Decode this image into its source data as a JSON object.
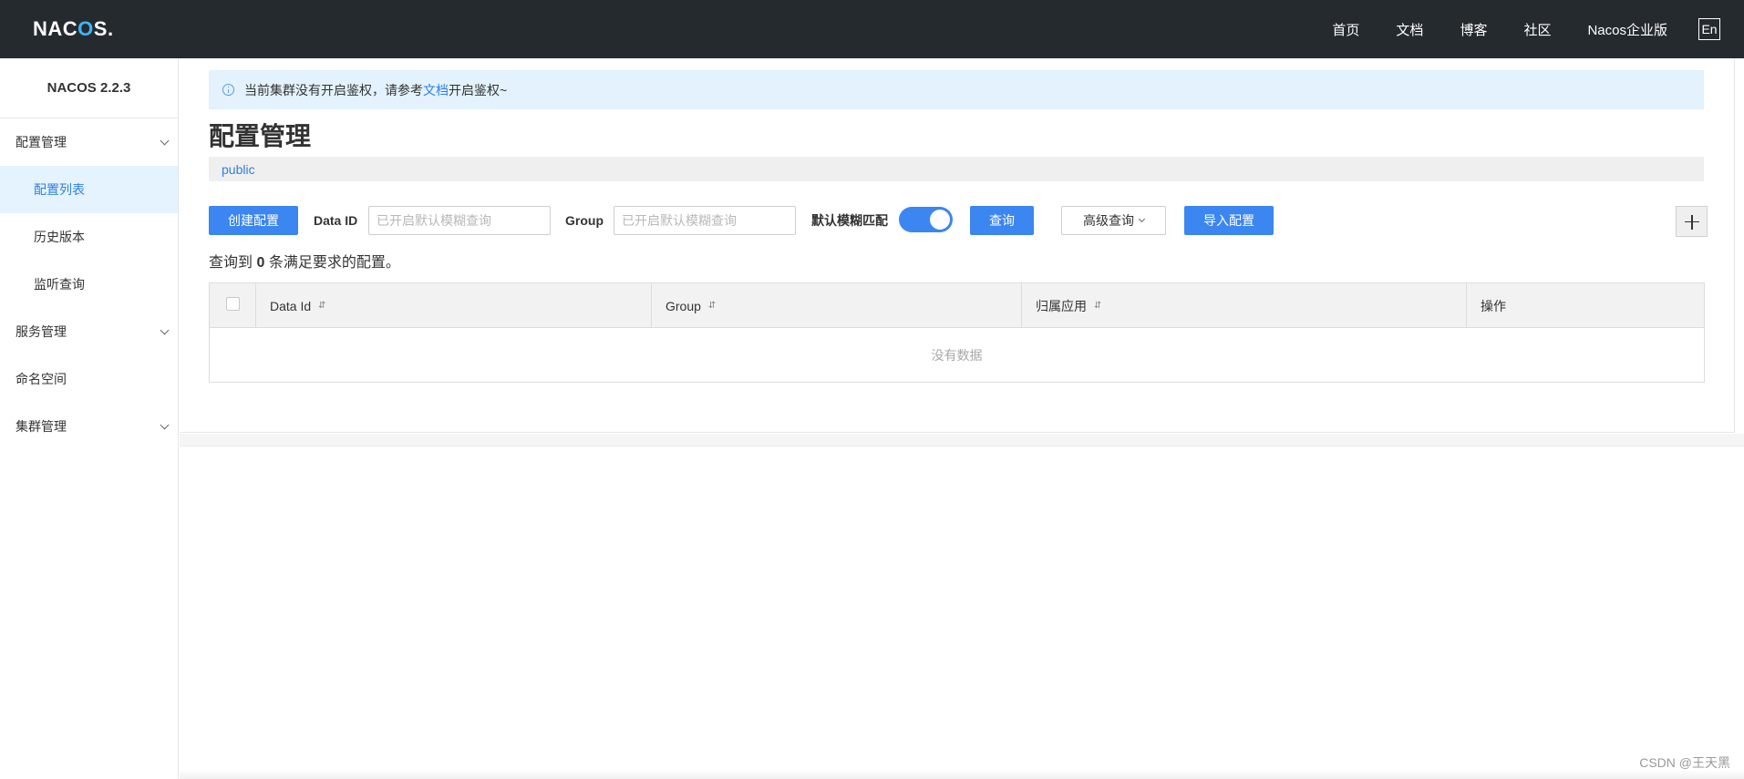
{
  "header": {
    "logo_left": "NAC",
    "logo_o": "O",
    "logo_right": "S",
    "logo_dot": ".",
    "nav": [
      "首页",
      "文档",
      "博客",
      "社区",
      "Nacos企业版"
    ],
    "lang": "En"
  },
  "sidebar": {
    "version": "NACOS 2.2.3",
    "config_group": "配置管理",
    "config_items": [
      "配置列表",
      "历史版本",
      "监听查询"
    ],
    "service_group": "服务管理",
    "namespace": "命名空间",
    "cluster_group": "集群管理"
  },
  "alert": {
    "text_before": "当前集群没有开启鉴权，请参考",
    "link": "文档",
    "text_after": "开启鉴权~"
  },
  "page": {
    "title": "配置管理",
    "namespace": "public"
  },
  "toolbar": {
    "create_label": "创建配置",
    "data_id_label": "Data ID",
    "data_id_placeholder": "已开启默认模糊查询",
    "group_label": "Group",
    "group_placeholder": "已开启默认模糊查询",
    "fuzzy_label": "默认模糊匹配",
    "fuzzy_on": true,
    "query_label": "查询",
    "advanced_label": "高级查询",
    "import_label": "导入配置"
  },
  "result": {
    "prefix": "查询到",
    "count": "0",
    "suffix": "条满足要求的配置。"
  },
  "table": {
    "columns": [
      "Data Id",
      "Group",
      "归属应用",
      "操作"
    ],
    "sort_icon": "⇵",
    "empty": "没有数据"
  },
  "watermark": "CSDN @王天黑"
}
